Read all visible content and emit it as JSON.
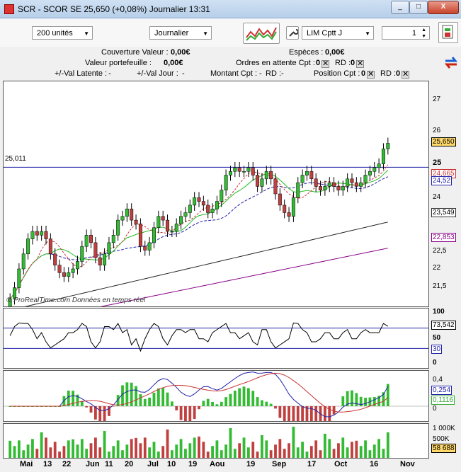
{
  "window": {
    "title": "SCR - SCOR SE    25,650 (+0,08%)    Journalier  13:31",
    "minimize": "_",
    "maximize": "□",
    "close": "X"
  },
  "toolbar": {
    "units": "200 unités",
    "period": "Journalier",
    "order_type": "LIM Cptt J",
    "quantity": "1"
  },
  "account": {
    "couverture_label": "Couverture Valeur :",
    "couverture_value": "0,00€",
    "especes_label": "Espèces :",
    "especes_value": "0,00€",
    "portefeuille_label": "Valeur portefeuille :",
    "portefeuille_value": "0,00€",
    "ordres_label": "Ordres en attente  Cpt :",
    "ordres_cpt": "0",
    "ordres_rd_label": "RD :",
    "ordres_rd": "0",
    "latente_label": "+/-Val Latente :",
    "latente_value": "-",
    "jour_label": "+/-Val Jour :",
    "jour_value": "-",
    "montant_label": "Montant  Cpt :",
    "montant_cpt": "-",
    "montant_rd_label": "RD :",
    "montant_rd": "-",
    "position_label": "Position  Cpt :",
    "position_cpt": "0",
    "position_rd_label": "RD :",
    "position_rd": "0"
  },
  "price_panel": {
    "hline_label": "25,011",
    "watermark": "© ProRealTime.com  Données en temps réel",
    "y_ticks": [
      "27",
      "26",
      "25",
      "24,5",
      "24",
      "23,5",
      "23",
      "22,5",
      "22",
      "21,5"
    ],
    "labels": {
      "last": "25,650",
      "ma_red": "24,665",
      "ma_blue": "24,52",
      "ma_black": "23,549",
      "ma_purple": "22,853"
    }
  },
  "rsi_panel": {
    "y_ticks": [
      "100",
      "50",
      "0"
    ],
    "value": "73,542",
    "level": "30"
  },
  "macd_panel": {
    "y_ticks": [
      "0,4",
      "0"
    ],
    "macd": "0,254",
    "signal": "0,1116"
  },
  "volume_panel": {
    "y_ticks": [
      "1 000K",
      "500K"
    ],
    "value": "58 688"
  },
  "x_axis": [
    "Mai",
    "13",
    "22",
    "Jun",
    "11",
    "20",
    "Jul",
    "10",
    "19",
    "Aou",
    "19",
    "Sep",
    "17",
    "Oct",
    "16",
    "Nov"
  ],
  "colors": {
    "up": "#33bb33",
    "down": "#c04040",
    "rsi": "#000000",
    "macd_fill_up": "#b7e3b0",
    "macd_fill_down": "#f0b8b8"
  },
  "chart_data": {
    "type": "candlestick",
    "title": "SCR - SCOR SE",
    "close": [
      21.5,
      21.8,
      22.3,
      22.7,
      23.1,
      23.3,
      23.2,
      23.3,
      23.1,
      22.7,
      22.4,
      22.2,
      22.1,
      22.2,
      22.3,
      22.5,
      22.9,
      23.2,
      23.0,
      22.6,
      22.4,
      22.7,
      23.0,
      23.2,
      23.6,
      23.7,
      23.9,
      23.6,
      23.5,
      22.9,
      22.8,
      23.0,
      23.4,
      23.7,
      23.6,
      23.3,
      23.3,
      23.5,
      23.7,
      23.8,
      24.0,
      24.2,
      24.1,
      24.0,
      23.8,
      23.9,
      24.1,
      24.4,
      24.8,
      24.9,
      25.0,
      24.9,
      24.9,
      25.0,
      24.8,
      24.5,
      24.7,
      24.9,
      24.7,
      24.3,
      24.0,
      23.8,
      23.7,
      24.2,
      24.6,
      24.8,
      24.9,
      24.7,
      24.5,
      24.4,
      24.5,
      24.6,
      24.5,
      24.4,
      24.5,
      24.7,
      24.6,
      24.5,
      24.6,
      24.8,
      24.9,
      25.0,
      25.1,
      25.5,
      25.65
    ],
    "ma_red_last": 24.665,
    "ma_blue_last": 24.52,
    "ma_black_last": 23.549,
    "ma_purple_last": 22.853,
    "rsi_last": 73.542,
    "macd_last": 0.254,
    "signal_last": 0.1116,
    "volume_last": 58688,
    "ylim": [
      21.3,
      27.3
    ]
  }
}
